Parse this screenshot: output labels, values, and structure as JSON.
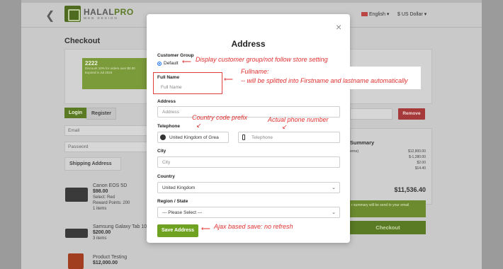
{
  "header": {
    "logo_main": "HALAL",
    "logo_accent": "PRO",
    "logo_sub": "WEB DESIGN",
    "language": "English ▾",
    "currency": "$ US Dollar ▾"
  },
  "checkout": {
    "title": "Checkout",
    "coupon_code": "2222",
    "coupon_desc": "Discount 10% for orders over $0.00",
    "coupon_expiry": "Expired in Jul 2023",
    "login_label": "Login",
    "register_label": "Register",
    "email_placeholder": "Email",
    "password_placeholder": "Password",
    "shipping_address_label": "Shipping Address",
    "remove_label": "Remove",
    "products": [
      {
        "name": "Canon EOS 5D",
        "price": "$98.00",
        "opt1": "Select: Red",
        "opt2": "Reward Points: 200",
        "qty": "1 items"
      },
      {
        "name": "Samsung Galaxy Tab 10.1",
        "price": "$200.00",
        "qty": "3 items"
      },
      {
        "name": "Product Testing",
        "price": "$12,000.00"
      }
    ]
  },
  "summary": {
    "title": "Summary",
    "items_label": "ems)",
    "values": [
      "$12,800.00",
      "$-1,280.00",
      "$2.00",
      "$14.40"
    ],
    "total": "$11,536.40",
    "note": "r summary will be send to your email",
    "checkout_label": "Checkout"
  },
  "modal": {
    "close": "×",
    "title": "Address",
    "customer_group_label": "Customer Group",
    "customer_group_value": "Default",
    "fullname_label": "Full Name",
    "fullname_placeholder": "Full Name",
    "address_label": "Address",
    "address_placeholder": "Address",
    "telephone_label": "Telephone",
    "country_code_value": "United Kingdom of Grea",
    "telephone_placeholder": "Telephone",
    "city_label": "City",
    "city_placeholder": "City",
    "country_label": "Country",
    "country_value": "United Kingdom",
    "region_label": "Region / State",
    "region_value": "--- Please Select ---",
    "save_label": "Save Address"
  },
  "annotations": {
    "customer_group": "Display customer group/not follow store setting",
    "fullname_title": "Fullname:",
    "fullname_detail": "-- will be splitted into Firstname and lastname automatically",
    "country_code": "Country code prefix",
    "phone": "Actual phone number",
    "save": "Ajax based save: no refresh"
  },
  "colors": {
    "accent_green": "#6fa221",
    "annotation_red": "#e03030",
    "remove_red": "#a63a3a"
  }
}
